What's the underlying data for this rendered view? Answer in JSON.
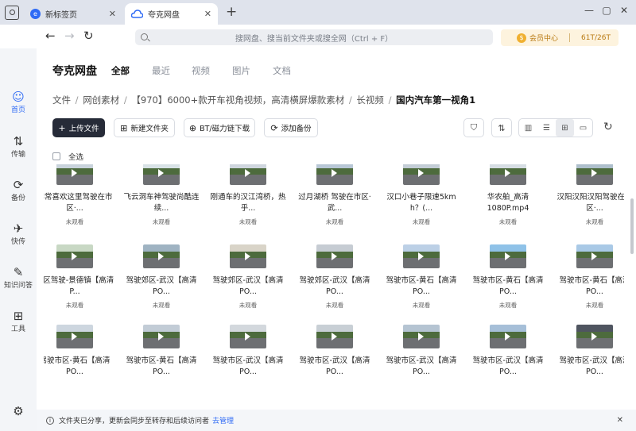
{
  "tabs": [
    {
      "label": "新标签页",
      "logo": "e"
    },
    {
      "label": "夸克网盘"
    }
  ],
  "window_controls": {
    "minimize": "—",
    "maximize": "▢",
    "close": "✕"
  },
  "search": {
    "placeholder": "搜网盘、搜当前文件夹或搜全网（Ctrl + F）"
  },
  "vip": {
    "coin": "$",
    "label": "会员中心",
    "storage": "61T/26T"
  },
  "rail": [
    {
      "label": "首页",
      "icon": "home-icon",
      "glyph": "☺"
    },
    {
      "label": "传输",
      "icon": "transfer-icon",
      "glyph": "⇅"
    },
    {
      "label": "备份",
      "icon": "backup-icon",
      "glyph": "⟳"
    },
    {
      "label": "快传",
      "icon": "quick-send-icon",
      "glyph": "✈"
    },
    {
      "label": "知识问答",
      "icon": "qa-icon",
      "glyph": "✎"
    },
    {
      "label": "工具",
      "icon": "toolbox-icon",
      "glyph": "⊞"
    },
    {
      "label": "",
      "icon": "settings-icon",
      "glyph": "⚙"
    }
  ],
  "brand": "夸克网盘",
  "category_tabs": [
    "全部",
    "最近",
    "视频",
    "图片",
    "文档"
  ],
  "breadcrumb": [
    "文件",
    "网创素材",
    "【970】6000+款开车视角视频，高清横屏爆款素材",
    "长视频",
    "国内汽车第一视角1"
  ],
  "actions": {
    "upload": "上传文件",
    "new_folder": "新建文件夹",
    "bt": "BT/磁力链下载",
    "backup": "添加备份"
  },
  "select_all": "全选",
  "files": [
    {
      "title": "非常喜欢这里驾驶在市区·...",
      "status": "未观看",
      "sky": "#c9d3dc"
    },
    {
      "title": "飞云洞车神驾驶尚酷连续...",
      "status": "未观看",
      "sky": "#d8e2e6"
    },
    {
      "title": "刚通车的汉江湾桥，热乎...",
      "status": "未观看",
      "sky": "#cfd6de"
    },
    {
      "title": "过月湖桥 驾驶在市区·武...",
      "status": "未观看",
      "sky": "#b8c7d6"
    },
    {
      "title": "汉口小巷子限速5km h？(...",
      "status": "未观看",
      "sky": "#c3cdd6"
    },
    {
      "title": "华农舶_高清1080P.mp4",
      "status": "未观看",
      "sky": "#d6dde3"
    },
    {
      "title": "汉阳汉阳汉阳驾驶在市区·...",
      "status": "未观看",
      "sky": "#aebfcc"
    },
    {
      "title": "郊区驾驶-景德镇【高清P...",
      "status": "未观看",
      "sky": "#c8d8c4"
    },
    {
      "title": "驾驶郊区-武汉【高清PO...",
      "status": "未观看",
      "sky": "#9fb3c2"
    },
    {
      "title": "驾驶郊区-武汉【高清PO...",
      "status": "未观看",
      "sky": "#d9d4c8"
    },
    {
      "title": "驾驶郊区-武汉【高清PO...",
      "status": "未观看",
      "sky": "#c6ccd3"
    },
    {
      "title": "驾驶市区-黄石【高清PO...",
      "status": "未观看",
      "sky": "#bcd0e6"
    },
    {
      "title": "驾驶市区-黄石【高清PO...",
      "status": "未观看",
      "sky": "#8fc2e8"
    },
    {
      "title": "驾驶市区-黄石【高清PO...",
      "status": "未观看",
      "sky": "#a9c9e6"
    },
    {
      "title": "驾驶市区-黄石【高清PO...",
      "status": "",
      "sky": "#cdd6df"
    },
    {
      "title": "驾驶市区-黄石【高清PO...",
      "status": "",
      "sky": "#c2ccd6"
    },
    {
      "title": "驾驶市区-武汉【高清PO...",
      "status": "",
      "sky": "#d3d8dd"
    },
    {
      "title": "驾驶市区-武汉【高清PO...",
      "status": "",
      "sky": "#c8cfd5"
    },
    {
      "title": "驾驶市区-武汉【高清PO...",
      "status": "",
      "sky": "#b5c4d2"
    },
    {
      "title": "驾驶市区-武汉【高清PO...",
      "status": "",
      "sky": "#a6bfd8"
    },
    {
      "title": "驾驶市区-武汉【高清PO...",
      "status": "",
      "sky": "#4f5560"
    }
  ],
  "notice": {
    "text": "文件夹已分享，更新会同步至转存和后续访问者",
    "link": "去管理",
    "info": "i",
    "close": "✕"
  }
}
